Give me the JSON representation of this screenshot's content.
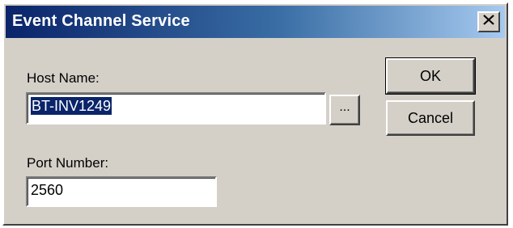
{
  "window": {
    "title": "Event Channel Service",
    "close_symbol": "✕"
  },
  "host": {
    "label": "Host Name:",
    "value": "BT-INV1249",
    "browse_label": "..."
  },
  "port": {
    "label": "Port Number:",
    "value": "2560"
  },
  "buttons": {
    "ok_label": "OK",
    "cancel_label": "Cancel"
  },
  "colors": {
    "titlebar_start": "#0a246a",
    "titlebar_end": "#a6caf0",
    "face": "#d4d0c8",
    "selection": "#0a246a"
  }
}
